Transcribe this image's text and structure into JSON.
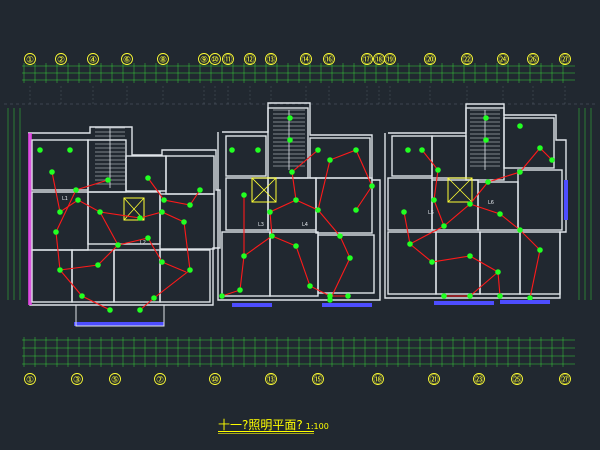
{
  "drawing_title": "十一?照明平面?",
  "drawing_scale": "1:100",
  "top_axis_labels": [
    "①",
    "②",
    "④",
    "⑥",
    "⑧",
    "⑨",
    "⑩",
    "⑪",
    "⑫",
    "⑬",
    "⑭",
    "⑯",
    "⑰",
    "⑱",
    "⑲",
    "⑳",
    "㉒",
    "㉔",
    "㉖",
    "㉗"
  ],
  "bottom_axis_labels": [
    "①",
    "③",
    "⑤",
    "⑦",
    "⑩",
    "⑬",
    "⑮",
    "⑱",
    "㉑",
    "㉓",
    "㉕",
    "㉗"
  ],
  "room_labels": [
    "L1",
    "L2",
    "L3",
    "L4",
    "L5",
    "L6",
    "L7",
    "L8",
    "L9",
    "L10",
    "L11",
    "L12"
  ],
  "colors": {
    "background": "#212830",
    "wall": "#dfe4e9",
    "wiring": "#ff1a1a",
    "fixture": "#22ff22",
    "axis": "#ffff33",
    "dimension": "#39d039",
    "panel": "#4d4dff",
    "frame": "#e83ee8",
    "title": "#ffff00"
  }
}
